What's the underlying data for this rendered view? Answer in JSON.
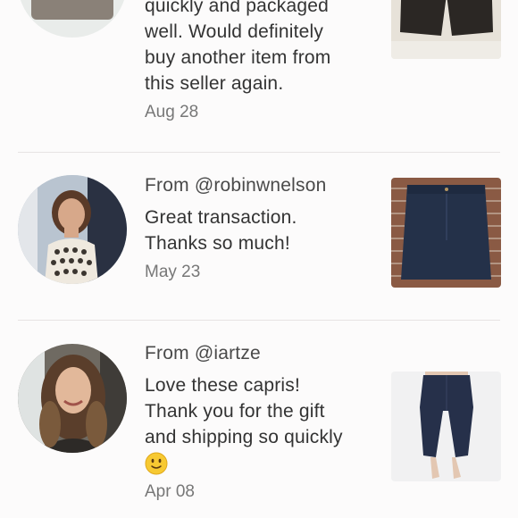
{
  "reviews": [
    {
      "from_prefix": "",
      "username": "",
      "message_lines": [
        "quickly and packaged",
        "well. Would definitely",
        "buy another item from",
        "this seller again."
      ],
      "date": "Aug 28",
      "avatar_icon": "plant-avatar-photo",
      "thumb_icon": "black-shorts-photo"
    },
    {
      "from_prefix": "From",
      "username": "@robinwnelson",
      "message_lines": [
        "Great transaction.",
        "Thanks so much!"
      ],
      "date": "May 23",
      "avatar_icon": "woman-avatar-photo",
      "thumb_icon": "denim-skirt-photo"
    },
    {
      "from_prefix": "From",
      "username": "@iartze",
      "message_lines": [
        "Love these capris!",
        "Thank you for the gift",
        "and shipping so quickly"
      ],
      "emoji": "slightly-smiling-face-icon",
      "date": "Apr 08",
      "avatar_icon": "woman-selfie-avatar-photo",
      "thumb_icon": "navy-capris-photo"
    }
  ],
  "colors": {
    "background": "#fcfbfb",
    "text": "#333333",
    "muted": "#777777",
    "divider": "#e6e3e3"
  }
}
